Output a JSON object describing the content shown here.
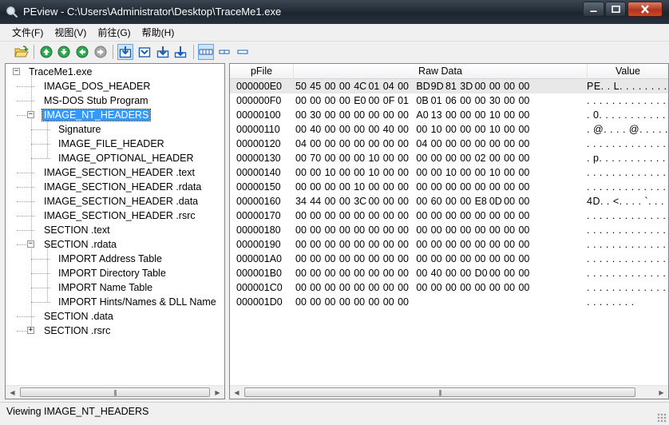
{
  "window": {
    "title": "PEview - C:\\Users\\Administrator\\Desktop\\TraceMe1.exe",
    "icon": "magnifier-icon"
  },
  "menu": [
    "文件(F)",
    "视图(V)",
    "前往(G)",
    "帮助(H)"
  ],
  "tree": [
    {
      "label": "TraceMe1.exe",
      "level": 0,
      "expander": "-"
    },
    {
      "label": "IMAGE_DOS_HEADER",
      "level": 1
    },
    {
      "label": "MS-DOS Stub Program",
      "level": 1
    },
    {
      "label": "IMAGE_NT_HEADERS",
      "level": 1,
      "expander": "-",
      "selected": true
    },
    {
      "label": "Signature",
      "level": 2
    },
    {
      "label": "IMAGE_FILE_HEADER",
      "level": 2
    },
    {
      "label": "IMAGE_OPTIONAL_HEADER",
      "level": 2
    },
    {
      "label": "IMAGE_SECTION_HEADER .text",
      "level": 1
    },
    {
      "label": "IMAGE_SECTION_HEADER .rdata",
      "level": 1
    },
    {
      "label": "IMAGE_SECTION_HEADER .data",
      "level": 1
    },
    {
      "label": "IMAGE_SECTION_HEADER .rsrc",
      "level": 1
    },
    {
      "label": "SECTION .text",
      "level": 1
    },
    {
      "label": "SECTION .rdata",
      "level": 1,
      "expander": "-"
    },
    {
      "label": "IMPORT Address Table",
      "level": 2
    },
    {
      "label": "IMPORT Directory Table",
      "level": 2
    },
    {
      "label": "IMPORT Name Table",
      "level": 2
    },
    {
      "label": "IMPORT Hints/Names & DLL Name",
      "level": 2
    },
    {
      "label": "SECTION .data",
      "level": 1
    },
    {
      "label": "SECTION .rsrc",
      "level": 1,
      "expander": "+"
    }
  ],
  "columns": {
    "pfile": "pFile",
    "raw": "Raw Data",
    "value": "Value"
  },
  "rows": [
    {
      "offset": "000000E0",
      "bytes": [
        "50",
        "45",
        "00",
        "00",
        "4C",
        "01",
        "04",
        "00",
        "BD",
        "9D",
        "81",
        "3D",
        "00",
        "00",
        "00",
        "00"
      ],
      "value": "PE. . L. . . . . . . . . . .",
      "selected": true
    },
    {
      "offset": "000000F0",
      "bytes": [
        "00",
        "00",
        "00",
        "00",
        "E0",
        "00",
        "0F",
        "01",
        "0B",
        "01",
        "06",
        "00",
        "00",
        "30",
        "00",
        "00"
      ],
      "value": ". . . . . . . . . . . . . . . ."
    },
    {
      "offset": "00000100",
      "bytes": [
        "00",
        "30",
        "00",
        "00",
        "00",
        "00",
        "00",
        "00",
        "A0",
        "13",
        "00",
        "00",
        "00",
        "10",
        "00",
        "00"
      ],
      "value": ". 0. . . . . . . . . . . . . ."
    },
    {
      "offset": "00000110",
      "bytes": [
        "00",
        "40",
        "00",
        "00",
        "00",
        "00",
        "40",
        "00",
        "00",
        "10",
        "00",
        "00",
        "00",
        "10",
        "00",
        "00"
      ],
      "value": ". @. . . . @. . . . . . . . ."
    },
    {
      "offset": "00000120",
      "bytes": [
        "04",
        "00",
        "00",
        "00",
        "00",
        "00",
        "00",
        "00",
        "04",
        "00",
        "00",
        "00",
        "00",
        "00",
        "00",
        "00"
      ],
      "value": ". . . . . . . . . . . . . . . ."
    },
    {
      "offset": "00000130",
      "bytes": [
        "00",
        "70",
        "00",
        "00",
        "00",
        "10",
        "00",
        "00",
        "00",
        "00",
        "00",
        "00",
        "02",
        "00",
        "00",
        "00"
      ],
      "value": ". p. . . . . . . . . . . . . ."
    },
    {
      "offset": "00000140",
      "bytes": [
        "00",
        "00",
        "10",
        "00",
        "00",
        "10",
        "00",
        "00",
        "00",
        "00",
        "10",
        "00",
        "00",
        "10",
        "00",
        "00"
      ],
      "value": ". . . . . . . . . . . . . . . ."
    },
    {
      "offset": "00000150",
      "bytes": [
        "00",
        "00",
        "00",
        "00",
        "10",
        "00",
        "00",
        "00",
        "00",
        "00",
        "00",
        "00",
        "00",
        "00",
        "00",
        "00"
      ],
      "value": ". . . . . . . . . . . . . . . ."
    },
    {
      "offset": "00000160",
      "bytes": [
        "34",
        "44",
        "00",
        "00",
        "3C",
        "00",
        "00",
        "00",
        "00",
        "60",
        "00",
        "00",
        "E8",
        "0D",
        "00",
        "00"
      ],
      "value": "4D. . <. . . . `. . . . . . ."
    },
    {
      "offset": "00000170",
      "bytes": [
        "00",
        "00",
        "00",
        "00",
        "00",
        "00",
        "00",
        "00",
        "00",
        "00",
        "00",
        "00",
        "00",
        "00",
        "00",
        "00"
      ],
      "value": ". . . . . . . . . . . . . . . ."
    },
    {
      "offset": "00000180",
      "bytes": [
        "00",
        "00",
        "00",
        "00",
        "00",
        "00",
        "00",
        "00",
        "00",
        "00",
        "00",
        "00",
        "00",
        "00",
        "00",
        "00"
      ],
      "value": ". . . . . . . . . . . . . . . ."
    },
    {
      "offset": "00000190",
      "bytes": [
        "00",
        "00",
        "00",
        "00",
        "00",
        "00",
        "00",
        "00",
        "00",
        "00",
        "00",
        "00",
        "00",
        "00",
        "00",
        "00"
      ],
      "value": ". . . . . . . . . . . . . . . ."
    },
    {
      "offset": "000001A0",
      "bytes": [
        "00",
        "00",
        "00",
        "00",
        "00",
        "00",
        "00",
        "00",
        "00",
        "00",
        "00",
        "00",
        "00",
        "00",
        "00",
        "00"
      ],
      "value": ". . . . . . . . . . . . . . . ."
    },
    {
      "offset": "000001B0",
      "bytes": [
        "00",
        "00",
        "00",
        "00",
        "00",
        "00",
        "00",
        "00",
        "00",
        "40",
        "00",
        "00",
        "D0",
        "00",
        "00",
        "00"
      ],
      "value": ". . . . . . . . . . . . . . . @."
    },
    {
      "offset": "000001C0",
      "bytes": [
        "00",
        "00",
        "00",
        "00",
        "00",
        "00",
        "00",
        "00",
        "00",
        "00",
        "00",
        "00",
        "00",
        "00",
        "00",
        "00"
      ],
      "value": ". . . . . . . . . . . . . . . ."
    },
    {
      "offset": "000001D0",
      "bytes": [
        "00",
        "00",
        "00",
        "00",
        "00",
        "00",
        "00",
        "00"
      ],
      "value": ". . . . . . . ."
    }
  ],
  "status": "Viewing IMAGE_NT_HEADERS"
}
